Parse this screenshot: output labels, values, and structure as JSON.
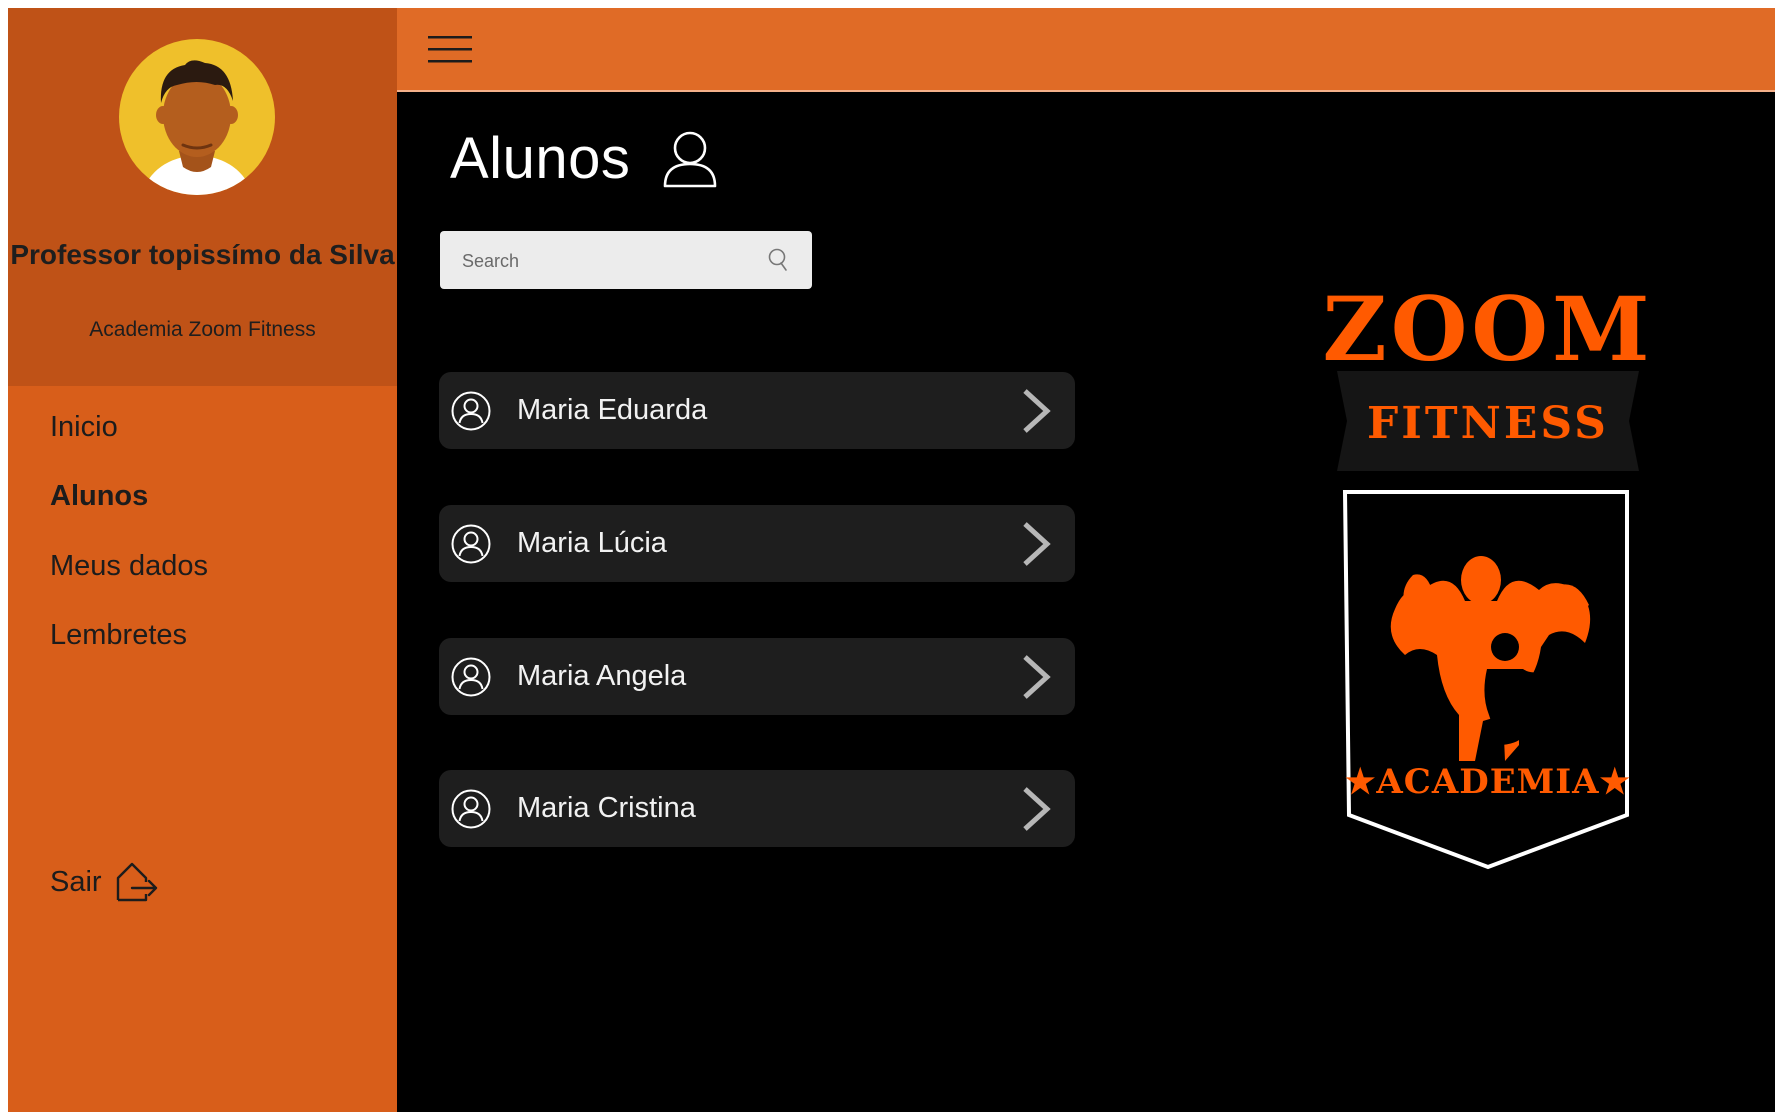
{
  "sidebar": {
    "profile": {
      "name": "Professor topissímo da Silva",
      "gym": "Academia Zoom Fitness"
    },
    "nav": [
      {
        "label": "Inicio",
        "active": false
      },
      {
        "label": "Alunos",
        "active": true
      },
      {
        "label": "Meus dados",
        "active": false
      },
      {
        "label": "Lembretes",
        "active": false
      }
    ],
    "logout_label": "Sair"
  },
  "main": {
    "title": "Alunos",
    "search": {
      "placeholder": "Search",
      "value": ""
    },
    "students": [
      {
        "name": "Maria Eduarda"
      },
      {
        "name": "Maria Lúcia"
      },
      {
        "name": "Maria Angela"
      },
      {
        "name": "Maria Cristina"
      }
    ],
    "logo": {
      "line1": "ZOOM",
      "line2": "FITNESS",
      "line3": "★ACADEMIA★"
    }
  },
  "colors": {
    "sidebar": "#d85e1a",
    "profile_panel": "#bf5217",
    "topbar": "#e06b26",
    "main_bg": "#000000",
    "row_bg": "#1e1e1e",
    "logo_orange": "#ff5a00"
  },
  "icons": {
    "menu": "hamburger-menu-icon",
    "title": "user-outline-icon",
    "search": "search-icon",
    "row_avatar": "user-circle-icon",
    "row_action": "chevron-right-icon",
    "logout": "logout-icon"
  }
}
